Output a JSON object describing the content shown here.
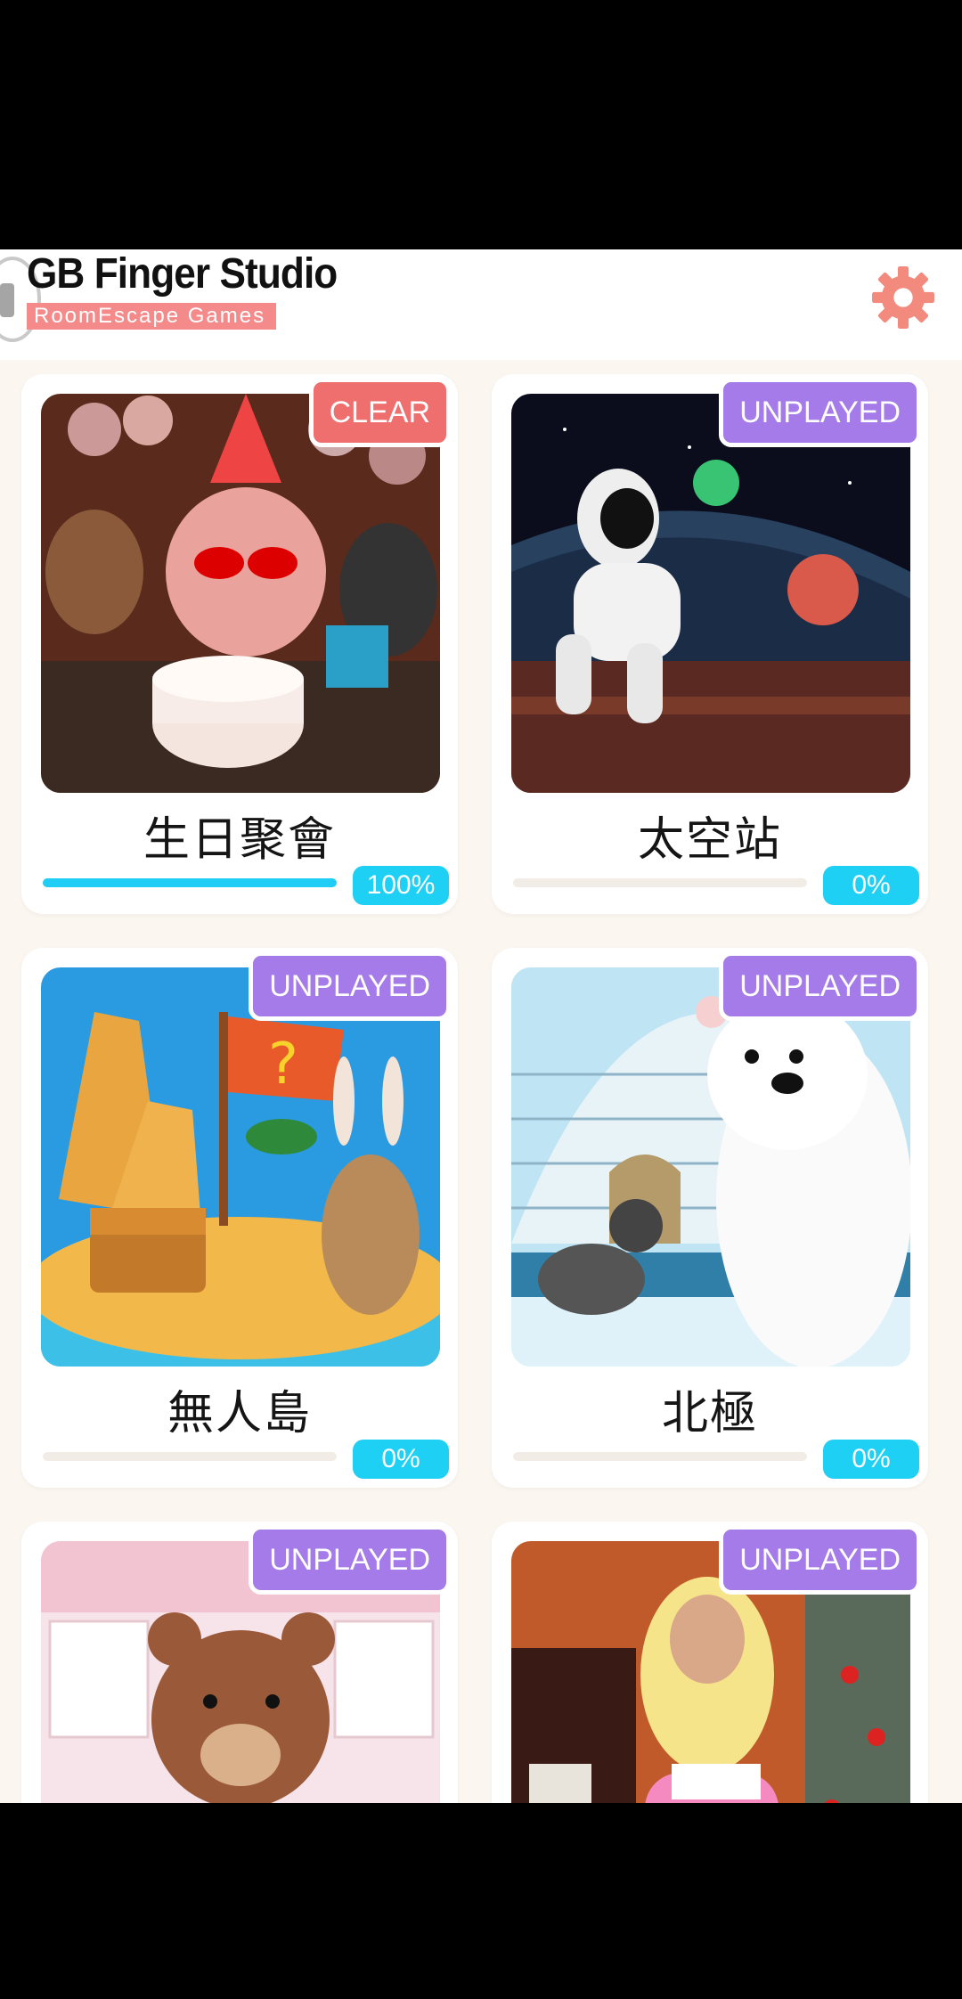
{
  "header": {
    "title": "GB Finger Studio",
    "subtitle": "RoomEscape  Games"
  },
  "colors": {
    "accent": "#f48a8a",
    "clear_badge": "#ef6e6e",
    "unplayed_badge": "#a47be8",
    "progress": "#1fcdf5"
  },
  "games": [
    {
      "name": "生日聚會",
      "status": "CLEAR",
      "progress_label": "100%",
      "progress": 1.0
    },
    {
      "name": "太空站",
      "status": "UNPLAYED",
      "progress_label": "0%",
      "progress": 0
    },
    {
      "name": "無人島",
      "status": "UNPLAYED",
      "progress_label": "0%",
      "progress": 0
    },
    {
      "name": "北極",
      "status": "UNPLAYED",
      "progress_label": "0%",
      "progress": 0
    },
    {
      "name": "",
      "status": "UNPLAYED",
      "progress_label": "",
      "progress": 0
    },
    {
      "name": "",
      "status": "UNPLAYED",
      "progress_label": "",
      "progress": 0
    }
  ]
}
